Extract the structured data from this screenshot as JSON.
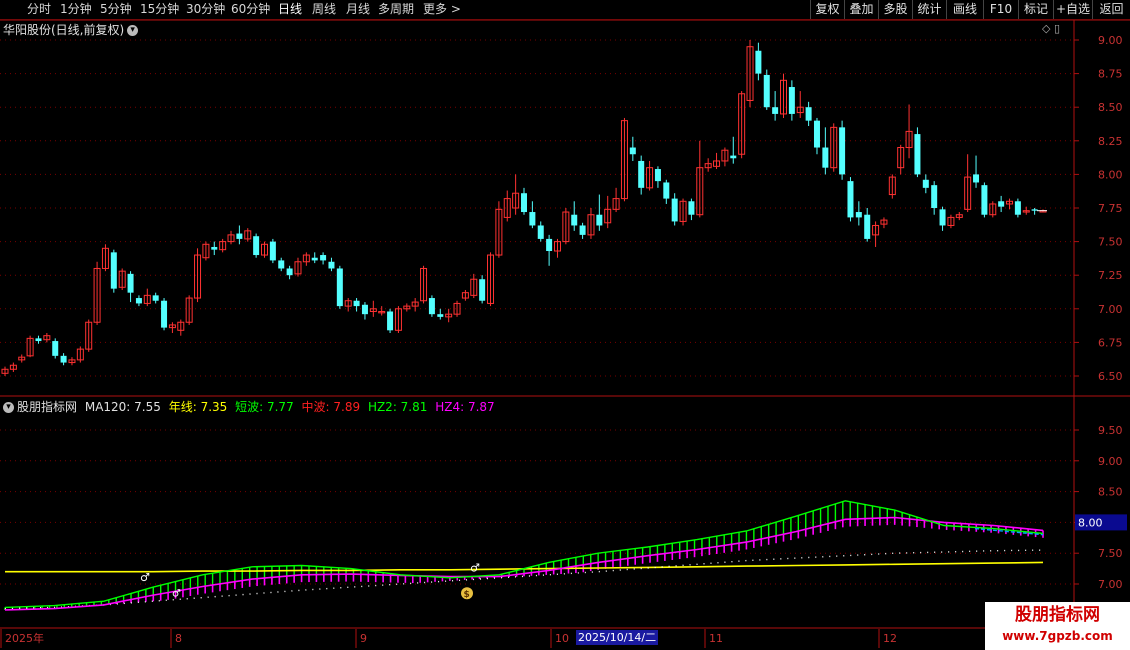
{
  "toolbar": {
    "tabs": [
      "分时",
      "1分钟",
      "5分钟",
      "15分钟",
      "30分钟",
      "60分钟",
      "日线",
      "周线",
      "月线",
      "多周期",
      "更多"
    ],
    "active": "日线",
    "right_buttons": [
      "复权",
      "叠加",
      "多股",
      "统计",
      "画线",
      "F10",
      "标记",
      "+自选",
      "返回"
    ]
  },
  "main": {
    "title": "华阳股份(日线,前复权)",
    "y_ticks": [
      "9.00",
      "8.75",
      "8.50",
      "8.25",
      "8.00",
      "7.75",
      "7.50",
      "7.25",
      "7.00",
      "6.75",
      "6.50"
    ]
  },
  "indicator": {
    "name": "股朋指标网",
    "values": [
      {
        "label": "MA120: 7.55",
        "color": "#e0e0e0"
      },
      {
        "label": "年线: 7.35",
        "color": "#ffff00"
      },
      {
        "label": "短波: 7.77",
        "color": "#00ff00"
      },
      {
        "label": "中波: 7.89",
        "color": "#ff2020"
      },
      {
        "label": "HZ2: 7.81",
        "color": "#00ff00"
      },
      {
        "label": "HZ4: 7.87",
        "color": "#ff00ff"
      }
    ],
    "y_ticks": [
      "9.50",
      "9.00",
      "8.50",
      "8.00",
      "7.50",
      "7.00"
    ],
    "current_value": "8.00"
  },
  "x_axis": {
    "labels": [
      "2025年",
      "8",
      "9",
      "10",
      "11",
      "12"
    ],
    "cursor_date": "2025/10/14/二"
  },
  "watermark": {
    "line1": "股朋指标网",
    "line2": "www.7gpzb.com"
  },
  "colors": {
    "up": "#ff3232",
    "down": "#54ffff",
    "grid": "#7a0000",
    "axis": "#b01010"
  },
  "chart_data": {
    "type": "candlestick",
    "ylim": [
      6.45,
      9.05
    ],
    "candles": [
      [
        6.52,
        6.55,
        6.5,
        6.57
      ],
      [
        6.55,
        6.58,
        6.53,
        6.6
      ],
      [
        6.62,
        6.64,
        6.6,
        6.66
      ],
      [
        6.65,
        6.78,
        6.64,
        6.8
      ],
      [
        6.78,
        6.76,
        6.74,
        6.8
      ],
      [
        6.77,
        6.8,
        6.75,
        6.82
      ],
      [
        6.76,
        6.65,
        6.63,
        6.78
      ],
      [
        6.65,
        6.6,
        6.58,
        6.67
      ],
      [
        6.6,
        6.62,
        6.58,
        6.64
      ],
      [
        6.62,
        6.7,
        6.6,
        6.72
      ],
      [
        6.7,
        6.9,
        6.68,
        6.92
      ],
      [
        6.9,
        7.3,
        6.88,
        7.35
      ],
      [
        7.3,
        7.45,
        7.28,
        7.48
      ],
      [
        7.42,
        7.15,
        7.12,
        7.44
      ],
      [
        7.16,
        7.28,
        7.14,
        7.3
      ],
      [
        7.26,
        7.12,
        7.05,
        7.28
      ],
      [
        7.08,
        7.04,
        7.02,
        7.1
      ],
      [
        7.04,
        7.1,
        7.02,
        7.15
      ],
      [
        7.1,
        7.06,
        7.04,
        7.12
      ],
      [
        7.06,
        6.86,
        6.84,
        7.08
      ],
      [
        6.86,
        6.88,
        6.82,
        6.9
      ],
      [
        6.84,
        6.9,
        6.8,
        6.92
      ],
      [
        6.9,
        7.08,
        6.88,
        7.1
      ],
      [
        7.08,
        7.4,
        7.05,
        7.45
      ],
      [
        7.38,
        7.48,
        7.36,
        7.5
      ],
      [
        7.46,
        7.44,
        7.4,
        7.5
      ],
      [
        7.44,
        7.5,
        7.42,
        7.52
      ],
      [
        7.5,
        7.55,
        7.48,
        7.58
      ],
      [
        7.56,
        7.52,
        7.48,
        7.62
      ],
      [
        7.52,
        7.58,
        7.5,
        7.6
      ],
      [
        7.54,
        7.4,
        7.38,
        7.56
      ],
      [
        7.4,
        7.48,
        7.38,
        7.5
      ],
      [
        7.5,
        7.36,
        7.34,
        7.52
      ],
      [
        7.36,
        7.3,
        7.28,
        7.38
      ],
      [
        7.3,
        7.25,
        7.22,
        7.32
      ],
      [
        7.26,
        7.35,
        7.24,
        7.38
      ],
      [
        7.35,
        7.4,
        7.32,
        7.42
      ],
      [
        7.38,
        7.36,
        7.34,
        7.42
      ],
      [
        7.4,
        7.36,
        7.33,
        7.42
      ],
      [
        7.35,
        7.3,
        7.28,
        7.38
      ],
      [
        7.3,
        7.02,
        7.0,
        7.32
      ],
      [
        7.02,
        7.06,
        6.98,
        7.08
      ],
      [
        7.06,
        7.02,
        6.98,
        7.08
      ],
      [
        7.03,
        6.96,
        6.92,
        7.05
      ],
      [
        6.98,
        7.0,
        6.94,
        7.06
      ],
      [
        6.97,
        6.98,
        6.95,
        7.02
      ],
      [
        6.98,
        6.84,
        6.82,
        7.0
      ],
      [
        6.84,
        7.0,
        6.82,
        7.02
      ],
      [
        7.0,
        7.02,
        6.98,
        7.04
      ],
      [
        7.02,
        7.05,
        6.98,
        7.08
      ],
      [
        7.06,
        7.3,
        7.04,
        7.32
      ],
      [
        7.08,
        6.96,
        6.94,
        7.1
      ],
      [
        6.96,
        6.94,
        6.92,
        7.0
      ],
      [
        6.94,
        6.96,
        6.9,
        7.0
      ],
      [
        6.96,
        7.04,
        6.94,
        7.06
      ],
      [
        7.08,
        7.12,
        7.06,
        7.14
      ],
      [
        7.1,
        7.22,
        7.08,
        7.26
      ],
      [
        7.22,
        7.06,
        7.04,
        7.25
      ],
      [
        7.04,
        7.4,
        7.02,
        7.42
      ],
      [
        7.4,
        7.74,
        7.38,
        7.8
      ],
      [
        7.68,
        7.82,
        7.65,
        7.88
      ],
      [
        7.75,
        7.86,
        7.7,
        8.0
      ],
      [
        7.86,
        7.72,
        7.7,
        7.9
      ],
      [
        7.72,
        7.62,
        7.6,
        7.8
      ],
      [
        7.62,
        7.52,
        7.5,
        7.65
      ],
      [
        7.52,
        7.43,
        7.32,
        7.55
      ],
      [
        7.43,
        7.5,
        7.38,
        7.52
      ],
      [
        7.5,
        7.72,
        7.48,
        7.75
      ],
      [
        7.7,
        7.62,
        7.58,
        7.8
      ],
      [
        7.62,
        7.55,
        7.52,
        7.64
      ],
      [
        7.55,
        7.7,
        7.52,
        7.75
      ],
      [
        7.7,
        7.62,
        7.58,
        7.85
      ],
      [
        7.64,
        7.74,
        7.6,
        7.84
      ],
      [
        7.74,
        7.82,
        7.72,
        7.9
      ],
      [
        7.82,
        8.4,
        7.8,
        8.42
      ],
      [
        8.2,
        8.15,
        8.1,
        8.28
      ],
      [
        8.1,
        7.9,
        7.85,
        8.14
      ],
      [
        7.9,
        8.05,
        7.88,
        8.1
      ],
      [
        8.04,
        7.95,
        7.9,
        8.06
      ],
      [
        7.94,
        7.82,
        7.78,
        7.96
      ],
      [
        7.82,
        7.65,
        7.62,
        7.86
      ],
      [
        7.65,
        7.8,
        7.62,
        7.82
      ],
      [
        7.8,
        7.7,
        7.66,
        7.82
      ],
      [
        7.7,
        8.05,
        7.68,
        8.25
      ],
      [
        8.05,
        8.08,
        8.02,
        8.12
      ],
      [
        8.06,
        8.1,
        8.04,
        8.16
      ],
      [
        8.1,
        8.18,
        8.06,
        8.2
      ],
      [
        8.14,
        8.12,
        8.08,
        8.28
      ],
      [
        8.15,
        8.6,
        8.12,
        8.62
      ],
      [
        8.55,
        8.95,
        8.5,
        9.0
      ],
      [
        8.92,
        8.75,
        8.7,
        8.98
      ],
      [
        8.74,
        8.5,
        8.48,
        8.78
      ],
      [
        8.5,
        8.45,
        8.4,
        8.62
      ],
      [
        8.45,
        8.7,
        8.42,
        8.75
      ],
      [
        8.65,
        8.45,
        8.4,
        8.7
      ],
      [
        8.46,
        8.5,
        8.42,
        8.62
      ],
      [
        8.5,
        8.4,
        8.36,
        8.54
      ],
      [
        8.4,
        8.2,
        8.15,
        8.42
      ],
      [
        8.2,
        8.05,
        8.0,
        8.35
      ],
      [
        8.05,
        8.35,
        8.02,
        8.38
      ],
      [
        8.35,
        8.0,
        7.96,
        8.4
      ],
      [
        7.95,
        7.68,
        7.65,
        7.98
      ],
      [
        7.72,
        7.68,
        7.62,
        7.8
      ],
      [
        7.7,
        7.52,
        7.5,
        7.75
      ],
      [
        7.55,
        7.62,
        7.46,
        7.65
      ],
      [
        7.63,
        7.66,
        7.6,
        7.68
      ],
      [
        7.85,
        7.98,
        7.82,
        8.0
      ],
      [
        8.05,
        8.2,
        8.0,
        8.22
      ],
      [
        8.2,
        8.32,
        8.12,
        8.52
      ],
      [
        8.3,
        8.0,
        7.98,
        8.35
      ],
      [
        7.96,
        7.9,
        7.86,
        8.0
      ],
      [
        7.92,
        7.75,
        7.7,
        7.95
      ],
      [
        7.74,
        7.62,
        7.58,
        7.76
      ],
      [
        7.62,
        7.68,
        7.6,
        7.7
      ],
      [
        7.68,
        7.7,
        7.66,
        7.72
      ],
      [
        7.74,
        7.98,
        7.72,
        8.15
      ],
      [
        8.0,
        7.94,
        7.9,
        8.14
      ],
      [
        7.92,
        7.7,
        7.68,
        7.94
      ],
      [
        7.7,
        7.78,
        7.68,
        7.8
      ],
      [
        7.8,
        7.76,
        7.72,
        7.84
      ],
      [
        7.78,
        7.8,
        7.74,
        7.82
      ],
      [
        7.8,
        7.7,
        7.68,
        7.82
      ],
      [
        7.72,
        7.73,
        7.7,
        7.76
      ],
      [
        7.74,
        7.73,
        7.7,
        7.75
      ],
      [
        7.72,
        7.73,
        7.72,
        7.74
      ]
    ],
    "indicator_ylim": [
      6.5,
      10.0
    ],
    "series": [
      {
        "name": "年线",
        "values": [
          7.2,
          7.2,
          7.2,
          7.2,
          7.21,
          7.21,
          7.22,
          7.22,
          7.23,
          7.23,
          7.24,
          7.25,
          7.26,
          7.27,
          7.28,
          7.29,
          7.3,
          7.31,
          7.32,
          7.33,
          7.34,
          7.35
        ]
      },
      {
        "name": "MA120",
        "values": [
          6.6,
          6.62,
          6.66,
          6.72,
          6.78,
          6.84,
          6.9,
          6.95,
          7.0,
          7.05,
          7.1,
          7.15,
          7.2,
          7.26,
          7.32,
          7.38,
          7.42,
          7.46,
          7.5,
          7.52,
          7.54,
          7.55
        ]
      },
      {
        "name": "短波",
        "values": [
          6.62,
          6.65,
          6.72,
          6.95,
          7.15,
          7.28,
          7.3,
          7.25,
          7.15,
          7.1,
          7.15,
          7.35,
          7.5,
          7.6,
          7.72,
          7.86,
          8.1,
          8.35,
          8.2,
          7.95,
          7.9,
          7.82
        ]
      },
      {
        "name": "HZ4",
        "values": [
          6.58,
          6.6,
          6.66,
          6.82,
          6.96,
          7.08,
          7.15,
          7.16,
          7.14,
          7.12,
          7.12,
          7.22,
          7.35,
          7.46,
          7.56,
          7.68,
          7.85,
          8.05,
          8.08,
          8.0,
          7.95,
          7.87
        ]
      }
    ]
  }
}
